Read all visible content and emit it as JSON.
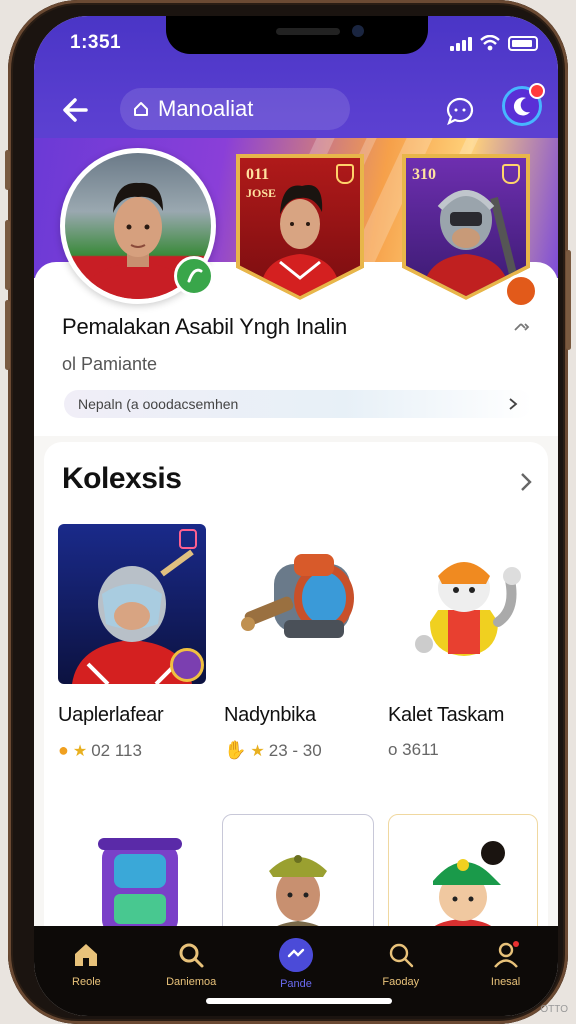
{
  "status_bar": {
    "time": "1:351"
  },
  "header": {
    "title": "Manoaliat"
  },
  "profile": {
    "name": "Pemalakan Asabil Yngh Inalin",
    "subtitle": "ol Pamiante",
    "info_pill": "Nepaln  (a ooodacsemhen",
    "card1_rating": "011",
    "card1_pos": "JOSE",
    "card2_rating": "310"
  },
  "collection": {
    "title": "Kolexsis",
    "items": [
      {
        "name": "Uaplerlafear",
        "meta": "02  113"
      },
      {
        "name": "Nadynbika",
        "meta": "23 - 30"
      },
      {
        "name": "Kalet Taskam",
        "meta": "o 3611"
      }
    ]
  },
  "bottom_nav": [
    {
      "label": "Reole"
    },
    {
      "label": "Daniemoa"
    },
    {
      "label": "Pande"
    },
    {
      "label": "Faoday"
    },
    {
      "label": "Inesal"
    }
  ],
  "watermark": "OTTO",
  "colors": {
    "accent": "#5a3fd0",
    "nav_bg": "#0d0a08",
    "nav_label": "#e8c27a"
  }
}
